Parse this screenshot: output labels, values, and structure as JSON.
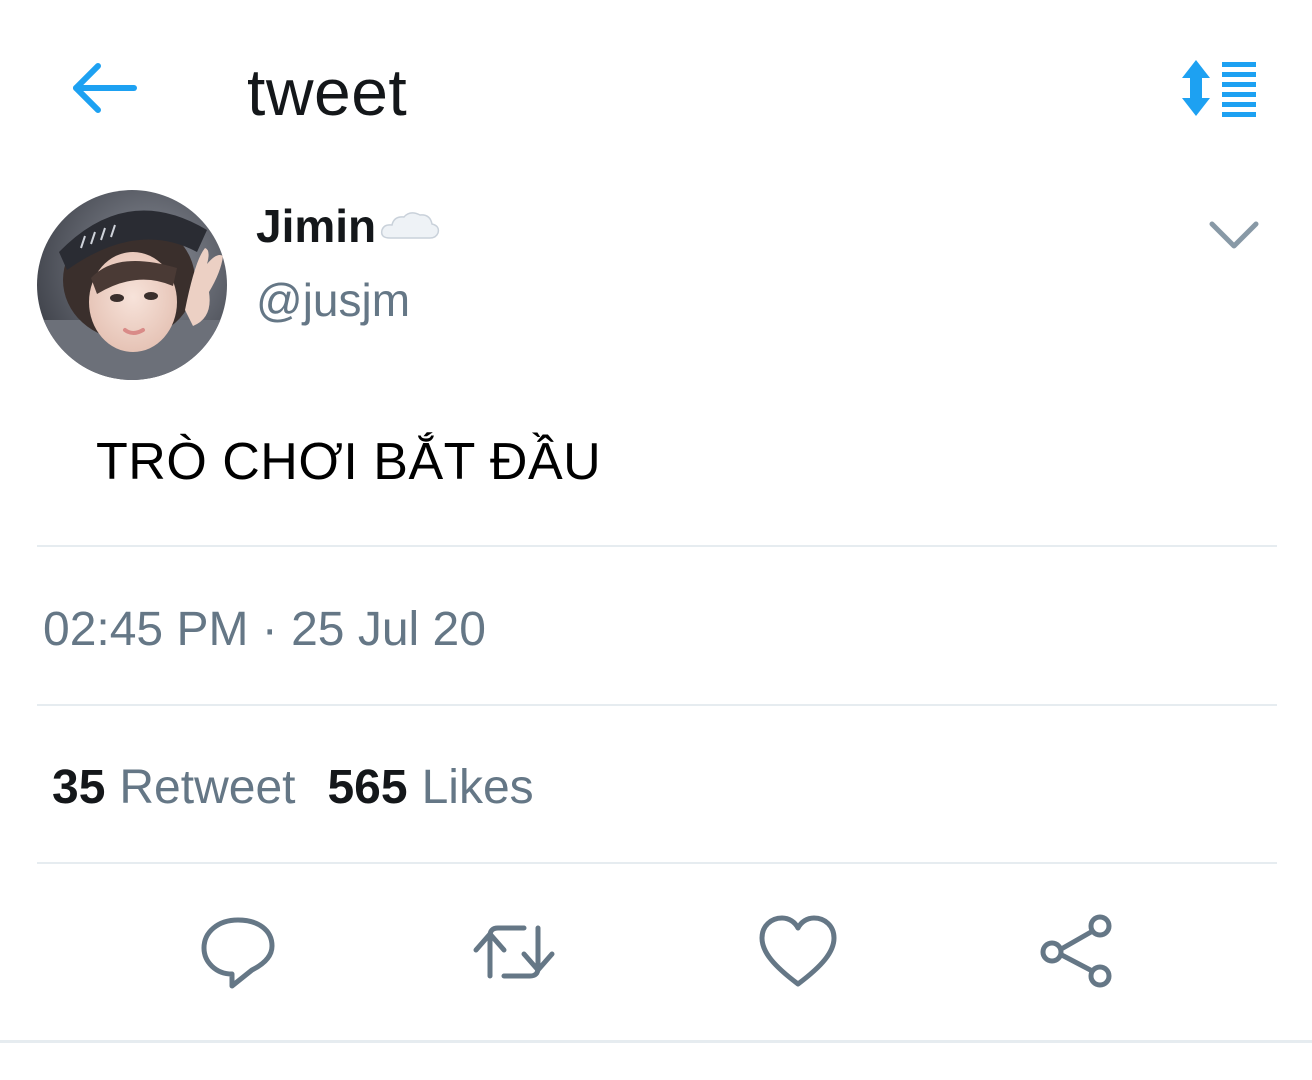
{
  "header": {
    "title": "tweet",
    "back_icon": "back-arrow-icon",
    "sort_icon": "sort-list-icon",
    "accent_color": "#1da1f2"
  },
  "author": {
    "display_name": "Jimin",
    "name_emoji": "cloud-icon",
    "handle": "@jusjm",
    "avatar_icon": "avatar-photo"
  },
  "tweet": {
    "text": "TRÒ CHƠI BẮT ĐẦU",
    "timestamp": "02:45 PM · 25 Jul 20"
  },
  "stats": {
    "retweet_count": "35",
    "retweet_label": "Retweet",
    "likes_count": "565",
    "likes_label": "Likes"
  },
  "actions": {
    "reply_icon": "reply-icon",
    "retweet_icon": "retweet-icon",
    "like_icon": "heart-icon",
    "share_icon": "share-icon",
    "icon_color": "#657786"
  },
  "colors": {
    "text_primary": "#14171a",
    "text_secondary": "#657786",
    "divider": "#e6ecf0"
  }
}
